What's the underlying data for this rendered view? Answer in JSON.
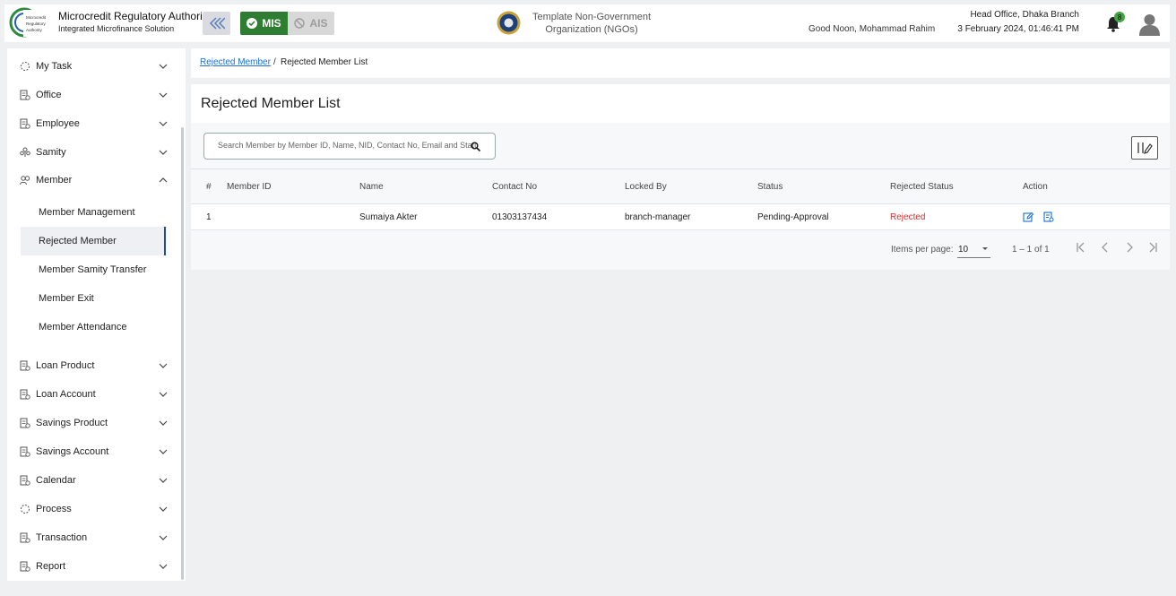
{
  "header": {
    "org_title": "Microcredit Regulatory Authority",
    "org_subtitle": "Integrated Microfinance Solution",
    "logo_text": "Microcredit Regulatory Authority",
    "mis_label": "MIS",
    "ais_label": "AIS",
    "ngo_name": "Template Non-Government Organization (NGOs)",
    "greeting": "Good Noon, Mohammad Rahim",
    "branch": "Head Office, Dhaka Branch",
    "datetime": "3 February 2024, 01:46:41 PM",
    "notification_count": "8"
  },
  "sidebar": {
    "items": [
      {
        "label": "My Task",
        "icon": "task-icon"
      },
      {
        "label": "Office",
        "icon": "office-icon"
      },
      {
        "label": "Employee",
        "icon": "employee-icon"
      },
      {
        "label": "Samity",
        "icon": "samity-icon"
      },
      {
        "label": "Member",
        "icon": "member-icon",
        "expanded": true
      },
      {
        "label": "Loan Product",
        "icon": "loan-product-icon"
      },
      {
        "label": "Loan Account",
        "icon": "loan-account-icon"
      },
      {
        "label": "Savings Product",
        "icon": "savings-product-icon"
      },
      {
        "label": "Savings Account",
        "icon": "savings-account-icon"
      },
      {
        "label": "Calendar",
        "icon": "calendar-icon"
      },
      {
        "label": "Process",
        "icon": "process-icon"
      },
      {
        "label": "Transaction",
        "icon": "transaction-icon"
      },
      {
        "label": "Report",
        "icon": "report-icon"
      }
    ],
    "member_sub": [
      {
        "label": "Member Management"
      },
      {
        "label": "Rejected Member",
        "active": true
      },
      {
        "label": "Member Samity Transfer"
      },
      {
        "label": "Member Exit"
      },
      {
        "label": "Member Attendance"
      }
    ]
  },
  "breadcrumb": {
    "link": "Rejected Member",
    "separator": "/",
    "current": "Rejected Member List"
  },
  "page": {
    "title": "Rejected Member List",
    "search_placeholder": "Search Member by Member ID, Name, NID, Contact No, Email and Status"
  },
  "table": {
    "headers": [
      "#",
      "Member ID",
      "Name",
      "Contact No",
      "Locked By",
      "Status",
      "Rejected Status",
      "Action"
    ],
    "rows": [
      {
        "idx": "1",
        "member_id": "",
        "name": "Sumaiya Akter",
        "contact": "01303137434",
        "locked_by": "branch-manager",
        "status": "Pending-Approval",
        "rejected_status": "Rejected"
      }
    ]
  },
  "pagination": {
    "items_per_page_label": "Items per page:",
    "items_per_page": "10",
    "range": "1 – 1 of 1"
  },
  "colors": {
    "mis_green": "#2e7d32",
    "link_blue": "#1a6fd6",
    "rejected_red": "#d32f2f",
    "active_border": "#1f4e99"
  }
}
